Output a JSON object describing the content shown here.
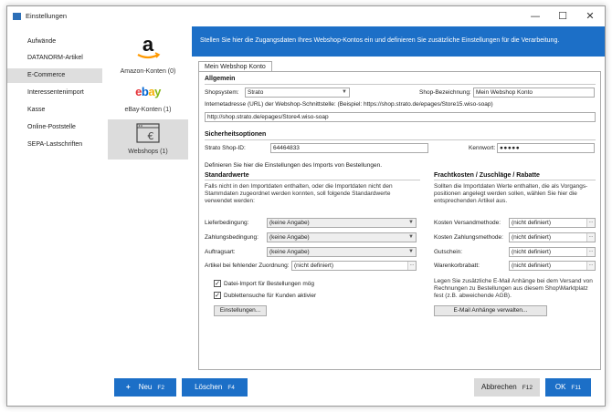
{
  "window": {
    "title": "Einstellungen",
    "minimize": "—",
    "maximize": "☐",
    "close": "✕"
  },
  "sidebar": {
    "items": [
      {
        "label": "Aufwände"
      },
      {
        "label": "DATANORM-Artikel"
      },
      {
        "label": "E-Commerce"
      },
      {
        "label": "Interessentenimport"
      },
      {
        "label": "Kasse"
      },
      {
        "label": "Online-Poststelle"
      },
      {
        "label": "SEPA-Lastschriften"
      }
    ]
  },
  "accounts": {
    "amazon_label": "Amazon-Konten (0)",
    "ebay_logo": "ebay",
    "ebay_label": "eBay-Konten (1)",
    "webshops_label": "Webshops (1)"
  },
  "banner": {
    "text": "Stellen Sie hier die Zugangsdaten Ihres Webshop-Kontos ein und definieren Sie zusätzliche Einstellungen für die Verarbeitung."
  },
  "tab": {
    "label": "Mein Webshop Konto"
  },
  "allgemein": {
    "heading": "Allgemein",
    "shopsystem_label": "Shopsystem:",
    "shopsystem_value": "Strato",
    "bezeichnung_label": "Shop-Bezeichnung:",
    "bezeichnung_value": "Mein Webshop Konto",
    "url_label": "Internetadresse (URL) der Webshop-Schnittstelle: (Beispiel: https://shop.strato.de/epages/Store15.wiso-soap)",
    "url_value": "http://shop.strato.de/epages/Store4.wiso-soap"
  },
  "sicherheit": {
    "heading": "Sicherheitsoptionen",
    "shopid_label": "Strato Shop-ID:",
    "shopid_value": "64464833",
    "kennwort_label": "Kennwort:",
    "kennwort_value": "●●●●●"
  },
  "import_intro": "Definieren Sie hier die Einstellungen des Imports von Bestellungen.",
  "standardwerte": {
    "heading": "Standardwerte",
    "description": "Falls nicht in den Importdaten enthalten, oder die Importdaten nicht den Stammdaten zugeordnet werden konnten, soll folgende Standardwerte verwendet werden:",
    "lieferbedingung_label": "Lieferbedingung:",
    "lieferbedingung_value": "(keine Angabe)",
    "zahlungsbedingung_label": "Zahlungsbedingung:",
    "zahlungsbedingung_value": "(keine Angabe)",
    "auftragsart_label": "Auftragsart:",
    "auftragsart_value": "(keine Angabe)",
    "artikel_label": "Artikel bei fehlender Zuordnung:",
    "artikel_value": "(nicht definiert)"
  },
  "fracht": {
    "heading": "Frachtkosten / Zuschläge / Rabatte",
    "description": "Sollten die Importdaten Werte enthalten, die als Vorgangs-positionen angelegt werden sollen, wählen Sie hier die entsprechenden Artikel aus.",
    "versand_label": "Kosten Versandmethode:",
    "versand_value": "(nicht definiert)",
    "zahlung_label": "Kosten Zahlungsmethode:",
    "zahlung_value": "(nicht definiert)",
    "gutschein_label": "Gutschein:",
    "gutschein_value": "(nicht definiert)",
    "warenkorb_label": "Warenkorbrabatt:",
    "warenkorb_value": "(nicht definiert)",
    "dots": "..."
  },
  "options": {
    "datei_import": "Datei-Import für Bestellungen mög",
    "dubletten": "Dublettensuche für Kunden aktivier",
    "check_mark": "✓",
    "einstellungen_button": "Einstellungen..."
  },
  "email": {
    "description": "Legen Sie zusätzliche E-Mail Anhänge bei dem Versand von Rechnungen zu Bestellungen aus diesem Shop\\Marktplatz fest (z.B. abweichende AGB).",
    "button": "E-Mail Anhänge verwalten..."
  },
  "footer": {
    "neu_icon": "+",
    "neu": "Neu",
    "neu_key": "F2",
    "loeschen": "Löschen",
    "loeschen_key": "F4",
    "abbrechen": "Abbrechen",
    "abbrechen_key": "F12",
    "ok": "OK",
    "ok_key": "F11"
  },
  "colors": {
    "accent": "#1c6fc7",
    "amazon_orange": "#ff9900"
  }
}
